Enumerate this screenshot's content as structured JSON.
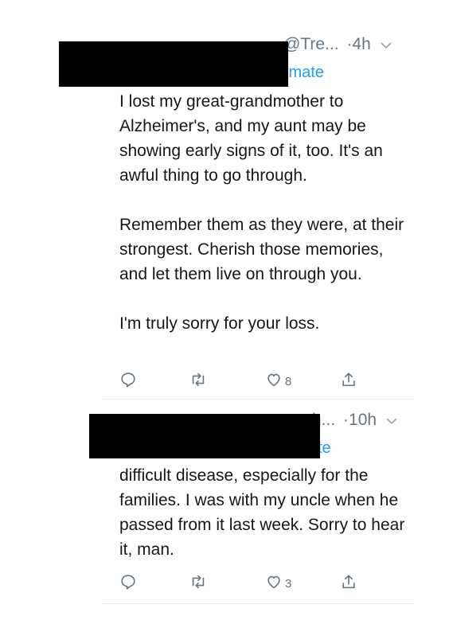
{
  "tweets": [
    {
      "handle": "@Tre...",
      "time": "·4h",
      "reply_fragment": "imate",
      "paragraphs": [
        "I lost my great-grandmother to Alzheimer's, and my aunt may be showing early signs of it, too. It's an awful thing to go through.",
        "Remember them as they were, at their strongest. Cherish those memories, and let them live on through you.",
        "I'm truly sorry for your loss."
      ],
      "likes": "8"
    },
    {
      "handle": "h...",
      "time": "·10h",
      "reply_fragment": "te",
      "paragraphs": [
        "difficult disease, especially for the families.  I was with my uncle when he passed from it last week. Sorry to hear it, man."
      ],
      "likes": "3"
    }
  ],
  "icons": {
    "reply": "reply-icon",
    "retweet": "retweet-icon",
    "like": "heart-icon",
    "share": "share-icon",
    "more": "chevron-down-icon"
  },
  "colors": {
    "text": "#14171a",
    "muted": "#657786",
    "link": "#1da1f2",
    "divider": "#e6ecf0",
    "redaction": "#000000"
  }
}
